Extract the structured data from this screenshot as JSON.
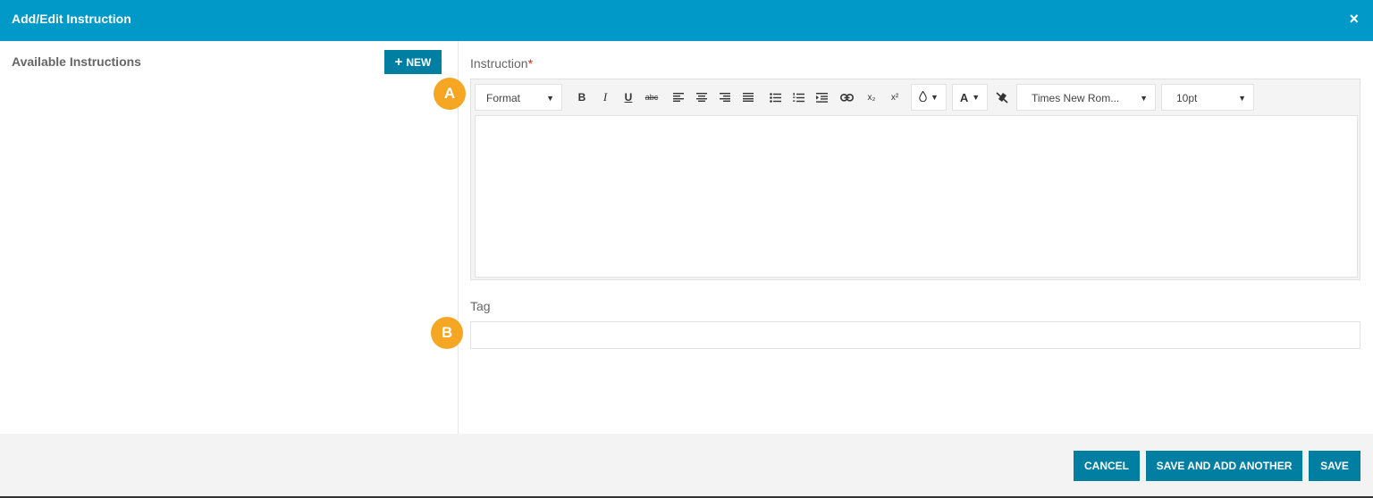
{
  "dialog": {
    "title": "Add/Edit Instruction",
    "close_glyph": "×"
  },
  "left": {
    "title": "Available Instructions",
    "new_plus": "+",
    "new_label": "NEW"
  },
  "form": {
    "instruction_label": "Instruction",
    "required_mark": "*",
    "tag_label": "Tag",
    "tag_value": ""
  },
  "toolbar": {
    "format_label": "Format",
    "bold": "B",
    "italic": "I",
    "underline": "U",
    "strike": "abc",
    "subscript": "x₂",
    "superscript": "x²",
    "font_color_letter": "A",
    "font_family": "Times New Rom...",
    "font_size": "10pt",
    "dropdown_arrow": "▼",
    "icons": [
      "bold-icon",
      "italic-icon",
      "underline-icon",
      "strikethrough-icon",
      "align-left-icon",
      "align-center-icon",
      "align-right-icon",
      "align-justify-icon",
      "bullet-list-icon",
      "numbered-list-icon",
      "indent-icon",
      "link-icon",
      "subscript-icon",
      "superscript-icon",
      "background-color-icon",
      "font-color-icon",
      "clear-formatting-icon"
    ]
  },
  "badges": {
    "a": "A",
    "b": "B"
  },
  "footer": {
    "cancel": "CANCEL",
    "save_add": "SAVE AND ADD ANOTHER",
    "save": "SAVE"
  },
  "colors": {
    "header": "#0099c8",
    "button": "#007fa3",
    "badge": "#f5a623",
    "required": "#e2231a",
    "footer": "#f3f3f3"
  }
}
